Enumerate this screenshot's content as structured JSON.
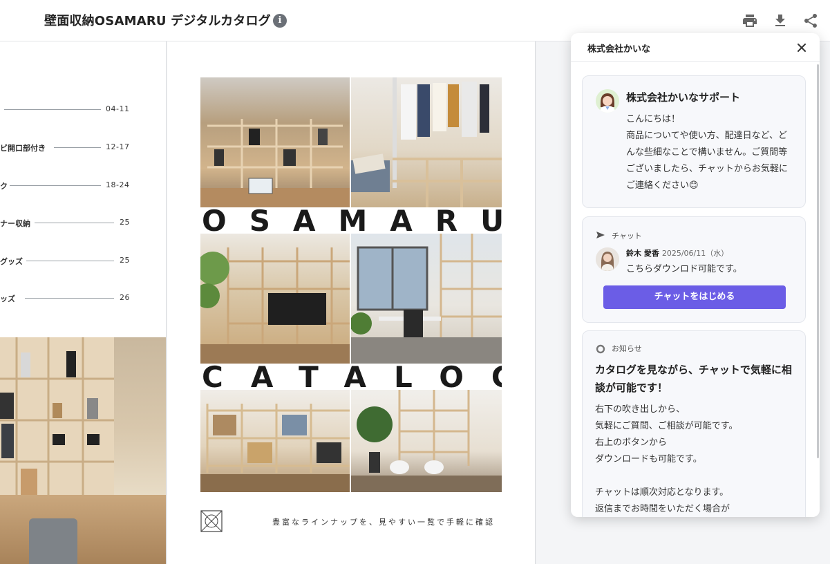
{
  "header": {
    "title": "壁面収納OSAMARU デジタルカタログ",
    "info_icon": "info-icon",
    "actions": [
      "print-icon",
      "download-icon",
      "share-icon"
    ]
  },
  "toc": [
    {
      "label": "",
      "page": "04-11"
    },
    {
      "label": "ビ開口部付き",
      "page": "12-17"
    },
    {
      "label": "ク",
      "page": "18-24"
    },
    {
      "label": "ナー収納",
      "page": "25"
    },
    {
      "label": "グッズ",
      "page": "25"
    },
    {
      "label": "ッズ",
      "page": "26"
    }
  ],
  "cover": {
    "word1": "OSAMARU",
    "word2": "CATALOG",
    "tagline": "豊富なラインナップを、見やすい一覧で手軽に確認"
  },
  "panel": {
    "title": "株式会社かいな",
    "support": {
      "name": "株式会社かいなサポート",
      "greeting": "こんにちは！\n商品についてや使い方、配達日など、どんな些細なことで構いません。ご質問等ございましたら、チャットからお気軽にご連絡ください😊"
    },
    "chat": {
      "label": "チャット",
      "sender": "鈴木 愛香",
      "time": "2025/06/11（水）",
      "message": "こちらダウンロド可能です。",
      "button": "チャットをはじめる"
    },
    "news": {
      "label": "お知らせ",
      "heading": "カタログを見ながら、チャットで気軽に相談が可能です！",
      "body": "右下の吹き出しから、\n気軽にご質問、ご相談が可能です。\n右上のボタンから\nダウンロードも可能です。\n\nチャットは順次対応となります。\n返信までお時間をいただく場合が"
    }
  },
  "colors": {
    "accent": "#6b5de6",
    "header_bg": "#ffffff",
    "viewer_bg": "#f4f5f7"
  }
}
